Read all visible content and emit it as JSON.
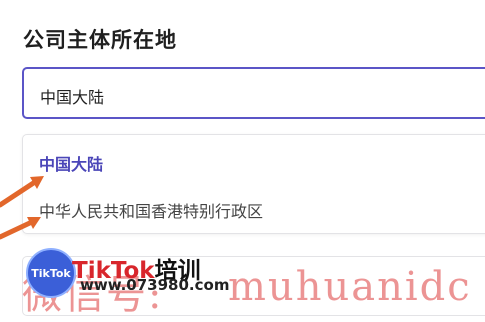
{
  "form": {
    "label": "公司主体所在地",
    "selected_value": "中国大陆",
    "options": [
      {
        "label": "中国大陆",
        "selected": true
      },
      {
        "label": "中华人民共和国香港特别行政区",
        "selected": false
      }
    ]
  },
  "watermark": {
    "logo_text": "TikTok",
    "brand_latin": "TikTok",
    "brand_cn": "培训",
    "site": "www.073980.com",
    "overlay_left": "微信号:",
    "overlay_right": "muhuanidc"
  },
  "colors": {
    "accent": "#5b55c7",
    "selected_option": "#4b46b8",
    "arrow": "#e2672b",
    "watermark_red": "#d8262c"
  }
}
